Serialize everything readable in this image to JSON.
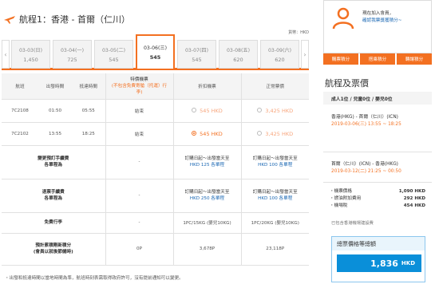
{
  "header": {
    "title": "航程1：香港 - 首爾（仁川）",
    "currency": "貨幣：HKD"
  },
  "date_tabs": [
    {
      "date": "03-03(日)",
      "price": "1,450",
      "active": false
    },
    {
      "date": "03-04(一)",
      "price": "725",
      "active": false
    },
    {
      "date": "03-05(二)",
      "price": "545",
      "active": false
    },
    {
      "date": "03-06(三)",
      "price": "545",
      "active": true
    },
    {
      "date": "03-07(四)",
      "price": "545",
      "active": false
    },
    {
      "date": "03-08(五)",
      "price": "620",
      "active": false
    },
    {
      "date": "03-09(六)",
      "price": "620",
      "active": false
    }
  ],
  "table": {
    "headers": {
      "flight": "航班",
      "depart": "出發時間",
      "arrive": "抵達時間",
      "special_l1": "特價機票",
      "special_l2": "(不包含免費寄艙（托運）行",
      "special_l3": "李)",
      "flex": "折扣機票",
      "std": "正常票價"
    },
    "flights": [
      {
        "no": "7C2108",
        "dep": "01:50",
        "arr": "05:55",
        "special": "結束",
        "flex": "545 HKD",
        "std": "3,425 HKD",
        "flex_selected": false
      },
      {
        "no": "7C2102",
        "dep": "13:55",
        "arr": "18:25",
        "special": "結束",
        "flex": "545 HKD",
        "std": "3,425 HKD",
        "flex_selected": true
      }
    ],
    "fee_rows": [
      {
        "title_l1": "變更預訂手續費",
        "title_l2": "各單程為",
        "special": "-",
        "flex_l1": "訂購日起～出發當天至",
        "flex_l2": "HKD 125 各單程",
        "std_l1": "訂購日起～出發當天至",
        "std_l2": "HKD 100 各單程"
      },
      {
        "title_l1": "退票手續費",
        "title_l2": "各單程為",
        "special": "-",
        "flex_l1": "訂購日起～出發當天至",
        "flex_l2": "HKD 250 各單程",
        "std_l1": "訂購日起～出發當天至",
        "std_l2": "HKD 100 各單程"
      }
    ],
    "baggage": {
      "title": "免費行李",
      "special": "-",
      "flex": "1PC/15KG (嬰兒10KG)",
      "std": "1PC/20KG (嬰兒10KG)"
    },
    "points": {
      "title_l1": "預計累積剛新積分",
      "title_l2": "(會員以就後節儲時)",
      "special": "0P",
      "flex": "3,678P",
      "std": "23,118P"
    }
  },
  "footnote": "・出發和抵達時間以當地時間為準，航班時刻表需取得政府許可，沒有提前通知可以變更。",
  "right": {
    "member_l1": "現在加入會員，",
    "member_l2": "確認我票獎獲積分~",
    "buttons": [
      "購票積分",
      "搭乘積分",
      "轉讓積分"
    ],
    "summary_title": "航程及票價",
    "pax": "成人1位 / 兒童0位 / 嬰兒0位",
    "seg1": {
      "badge": "去程",
      "route": "香港(HKG) - 首爾（仁川）(ICN)",
      "datetime": "2019-03-06(三) 13:55 ~ 18:25"
    },
    "seg2": {
      "badge": "回程",
      "route": "首爾（仁川）(ICN) - 香港(HKG)",
      "datetime": "2019-03-12(二) 21:25 ~ 00:50"
    },
    "costs": [
      {
        "label": "・機票價格",
        "value": "1,090 HKD"
      },
      {
        "label": "・燃油附加費用",
        "value": "292 HKD"
      },
      {
        "label": "・機場稅",
        "value": "454 HKD"
      }
    ],
    "tax_note": "已包含香港機場建設費",
    "total_label": "總票價格等總額",
    "total_amount": "1,836",
    "total_currency": "HKD"
  },
  "colors": {
    "accent": "#f37021",
    "link": "#1a67b3",
    "total_blue": "#0a8fd9"
  }
}
